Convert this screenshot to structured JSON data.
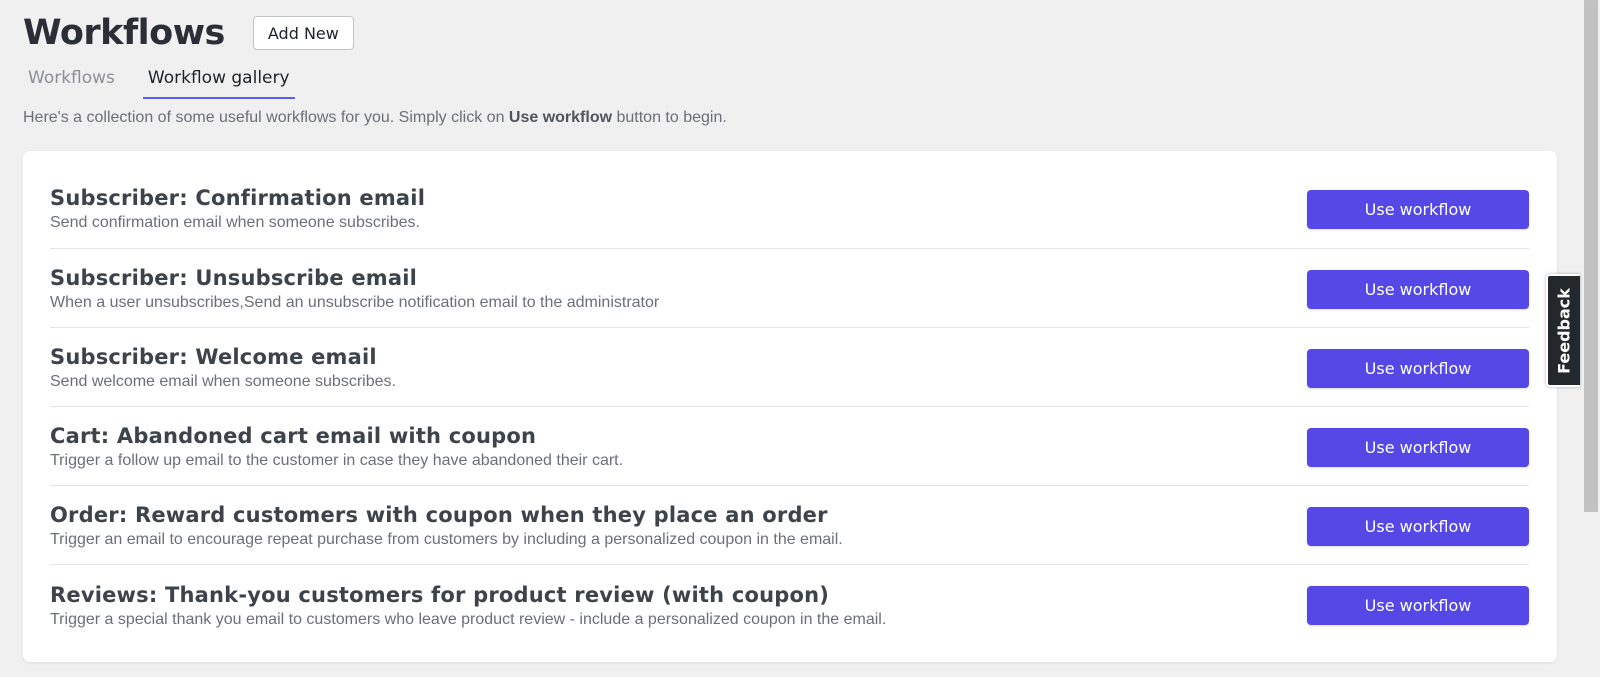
{
  "header": {
    "title": "Workflows",
    "add_new_label": "Add New"
  },
  "tabs": [
    {
      "label": "Workflows",
      "active": false
    },
    {
      "label": "Workflow gallery",
      "active": true
    }
  ],
  "intro": {
    "before": "Here's a collection of some useful workflows for you. Simply click on ",
    "bold": "Use workflow",
    "after": " button to begin."
  },
  "workflows": [
    {
      "title": "Subscriber: Confirmation email",
      "description": "Send confirmation email when someone subscribes.",
      "button": "Use workflow"
    },
    {
      "title": "Subscriber: Unsubscribe email",
      "description": "When a user unsubscribes,Send an unsubscribe notification email to the administrator",
      "button": "Use workflow"
    },
    {
      "title": "Subscriber: Welcome email",
      "description": "Send welcome email when someone subscribes.",
      "button": "Use workflow"
    },
    {
      "title": "Cart: Abandoned cart email with coupon",
      "description": "Trigger a follow up email to the customer in case they have abandoned their cart.",
      "button": "Use workflow"
    },
    {
      "title": "Order: Reward customers with coupon when they place an order",
      "description": "Trigger an email to encourage repeat purchase from customers by including a personalized coupon in the email.",
      "button": "Use workflow"
    },
    {
      "title": "Reviews: Thank-you customers for product review (with coupon)",
      "description": "Trigger a special thank you email to customers who leave product review - include a personalized coupon in the email.",
      "button": "Use workflow"
    }
  ],
  "feedback": {
    "label": "Feedback"
  },
  "colors": {
    "accent": "#5648e6",
    "tab_underline": "#5b5fe8",
    "background": "#f0f0f1",
    "feedback_bg": "#23282d"
  }
}
